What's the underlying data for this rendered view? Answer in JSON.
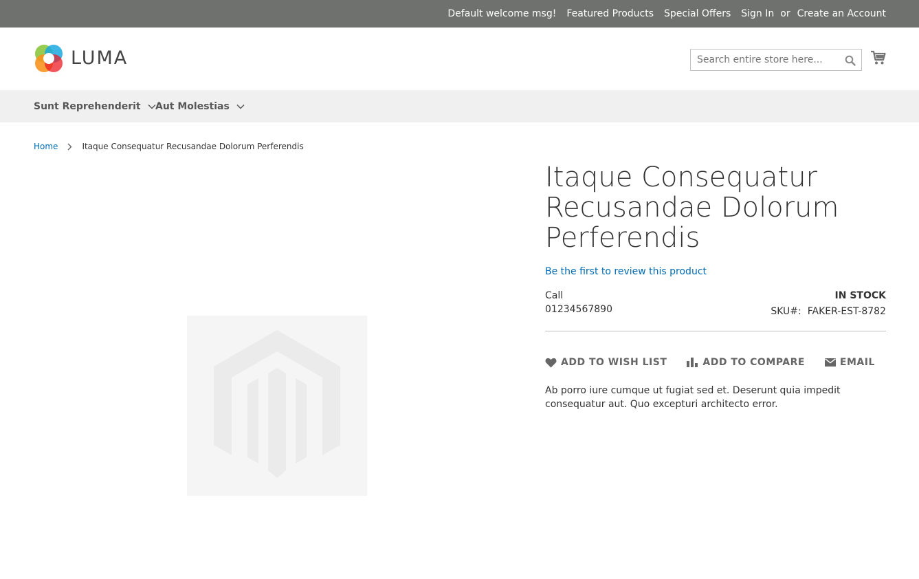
{
  "top_bar": {
    "welcome": "Default welcome msg!",
    "links": [
      "Featured Products",
      "Special Offers",
      "Sign In"
    ],
    "or_text": "or",
    "create_account": "Create an Account"
  },
  "header": {
    "logo_text": "LUMA",
    "search_placeholder": "Search entire store here...",
    "search_icon": "search-icon",
    "cart_icon": "cart-icon"
  },
  "nav": {
    "items": [
      {
        "label": "Sunt Reprehenderit"
      },
      {
        "label": "Aut Molestias"
      }
    ]
  },
  "breadcrumb": {
    "home": "Home",
    "current": "Itaque Consequatur Recusandae Dolorum Perferendis"
  },
  "product": {
    "title": "Itaque Consequatur Recusandae Dolorum Perferendis",
    "review_link": "Be the first to review this product",
    "call_label": "Call",
    "phone": "01234567890",
    "stock": "In stock",
    "sku_label": "SKU#:",
    "sku": "FAKER-EST-8782",
    "actions": {
      "wishlist": "ADD TO WISH LIST",
      "compare": "ADD TO COMPARE",
      "email": "EMAIL"
    },
    "description": "Ab porro iure cumque ut fugiat sed et. Deserunt quia impedit consequatur aut. Quo excepturi architecto error."
  },
  "colors": {
    "top_bar": "#6e716e",
    "link": "#006bb4",
    "nav_bg": "#f0f0f0"
  }
}
